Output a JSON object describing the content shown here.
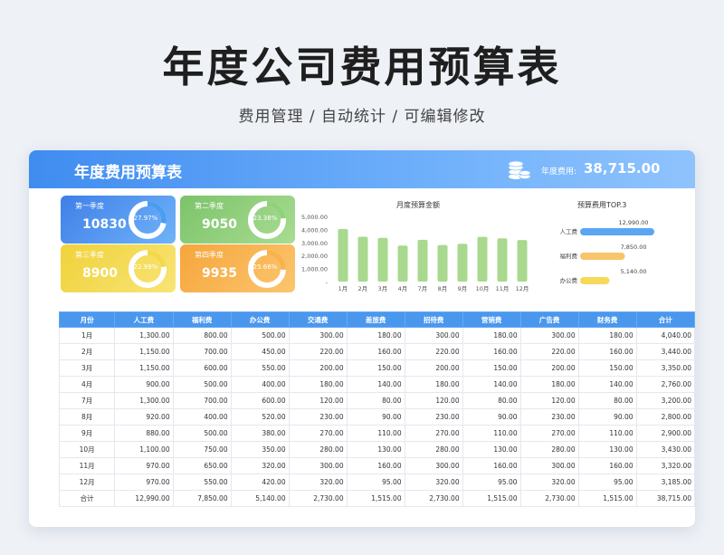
{
  "title": "年度公司费用预算表",
  "subtitle": "费用管理 / 自动统计 / 可编辑修改",
  "banner": {
    "title": "年度费用预算表",
    "total_label": "年度费用:",
    "total_value": "38,715.00"
  },
  "quarters": [
    {
      "label": "第一季度",
      "value": "10830",
      "pct": "27.97%",
      "fraction": 0.2797,
      "from": "#3f7fe8",
      "to": "#6fb3f8",
      "ring": "#4a9df0"
    },
    {
      "label": "第二季度",
      "value": "9050",
      "pct": "23.38%",
      "fraction": 0.2338,
      "from": "#7cc36a",
      "to": "#a8dc92",
      "ring": "#8fd27a"
    },
    {
      "label": "第三季度",
      "value": "8900",
      "pct": "22.99%",
      "fraction": 0.2299,
      "from": "#f0d23a",
      "to": "#f8e476",
      "ring": "#f4d84c"
    },
    {
      "label": "第四季度",
      "value": "9935",
      "pct": "25.66%",
      "fraction": 0.2566,
      "from": "#f6a53c",
      "to": "#fbc66e",
      "ring": "#f8b24e"
    }
  ],
  "chart_data": [
    {
      "type": "bar",
      "title": "月度预算金额",
      "categories": [
        "1月",
        "2月",
        "3月",
        "4月",
        "7月",
        "8月",
        "9月",
        "10月",
        "11月",
        "12月"
      ],
      "values": [
        4040,
        3440,
        3350,
        2760,
        3200,
        2800,
        2900,
        3430,
        3320,
        3185
      ],
      "yticks": [
        "5,000.00",
        "4,000.00",
        "3,000.00",
        "2,000.00",
        "1,000.00",
        "-"
      ],
      "ylim": [
        0,
        5000
      ],
      "color": "#a8d98e"
    },
    {
      "type": "bar",
      "orientation": "horizontal",
      "title": "预算费用TOP.3",
      "categories": [
        "人工费",
        "福利费",
        "办公费"
      ],
      "values": [
        12990,
        7850,
        5140
      ],
      "value_labels": [
        "12,990.00",
        "7,850.00",
        "5,140.00"
      ],
      "colors": [
        "#5aa6f2",
        "#f8c46a",
        "#f5d95a"
      ]
    }
  ],
  "table": {
    "headers": [
      "月份",
      "人工费",
      "福利费",
      "办公费",
      "交通费",
      "差旅费",
      "招待费",
      "营销费",
      "广告费",
      "财务费",
      "合计"
    ],
    "rows": [
      [
        "1月",
        "1,300.00",
        "800.00",
        "500.00",
        "300.00",
        "180.00",
        "300.00",
        "180.00",
        "300.00",
        "180.00",
        "4,040.00"
      ],
      [
        "2月",
        "1,150.00",
        "700.00",
        "450.00",
        "220.00",
        "160.00",
        "220.00",
        "160.00",
        "220.00",
        "160.00",
        "3,440.00"
      ],
      [
        "3月",
        "1,150.00",
        "600.00",
        "550.00",
        "200.00",
        "150.00",
        "200.00",
        "150.00",
        "200.00",
        "150.00",
        "3,350.00"
      ],
      [
        "4月",
        "900.00",
        "500.00",
        "400.00",
        "180.00",
        "140.00",
        "180.00",
        "140.00",
        "180.00",
        "140.00",
        "2,760.00"
      ],
      [
        "7月",
        "1,300.00",
        "700.00",
        "600.00",
        "120.00",
        "80.00",
        "120.00",
        "80.00",
        "120.00",
        "80.00",
        "3,200.00"
      ],
      [
        "8月",
        "920.00",
        "400.00",
        "520.00",
        "230.00",
        "90.00",
        "230.00",
        "90.00",
        "230.00",
        "90.00",
        "2,800.00"
      ],
      [
        "9月",
        "880.00",
        "500.00",
        "380.00",
        "270.00",
        "110.00",
        "270.00",
        "110.00",
        "270.00",
        "110.00",
        "2,900.00"
      ],
      [
        "10月",
        "1,100.00",
        "750.00",
        "350.00",
        "280.00",
        "130.00",
        "280.00",
        "130.00",
        "280.00",
        "130.00",
        "3,430.00"
      ],
      [
        "11月",
        "970.00",
        "650.00",
        "320.00",
        "300.00",
        "160.00",
        "300.00",
        "160.00",
        "300.00",
        "160.00",
        "3,320.00"
      ],
      [
        "12月",
        "970.00",
        "550.00",
        "420.00",
        "320.00",
        "95.00",
        "320.00",
        "95.00",
        "320.00",
        "95.00",
        "3,185.00"
      ],
      [
        "合计",
        "12,990.00",
        "7,850.00",
        "5,140.00",
        "2,730.00",
        "1,515.00",
        "2,730.00",
        "1,515.00",
        "2,730.00",
        "1,515.00",
        "38,715.00"
      ]
    ]
  }
}
